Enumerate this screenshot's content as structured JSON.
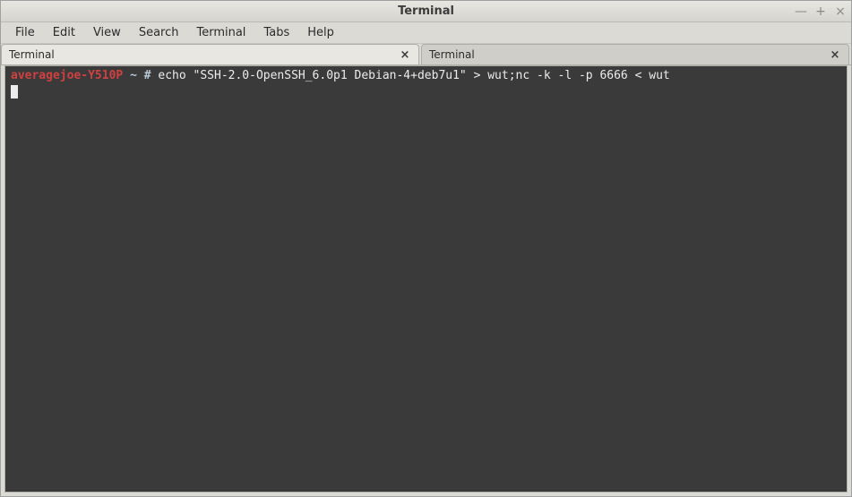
{
  "window": {
    "title": "Terminal"
  },
  "menubar": {
    "items": [
      "File",
      "Edit",
      "View",
      "Search",
      "Terminal",
      "Tabs",
      "Help"
    ]
  },
  "tabs": [
    {
      "label": "Terminal",
      "active": true
    },
    {
      "label": "Terminal",
      "active": false
    }
  ],
  "terminal": {
    "prompt_host": "averagejoe-Y510P",
    "prompt_path": "~",
    "prompt_symbol": "#",
    "command": "echo \"SSH-2.0-OpenSSH_6.0p1 Debian-4+deb7u1\" > wut;nc -k -l -p 6666 < wut"
  },
  "icons": {
    "minimize": "—",
    "maximize": "+",
    "close": "×",
    "tab_close": "×"
  }
}
